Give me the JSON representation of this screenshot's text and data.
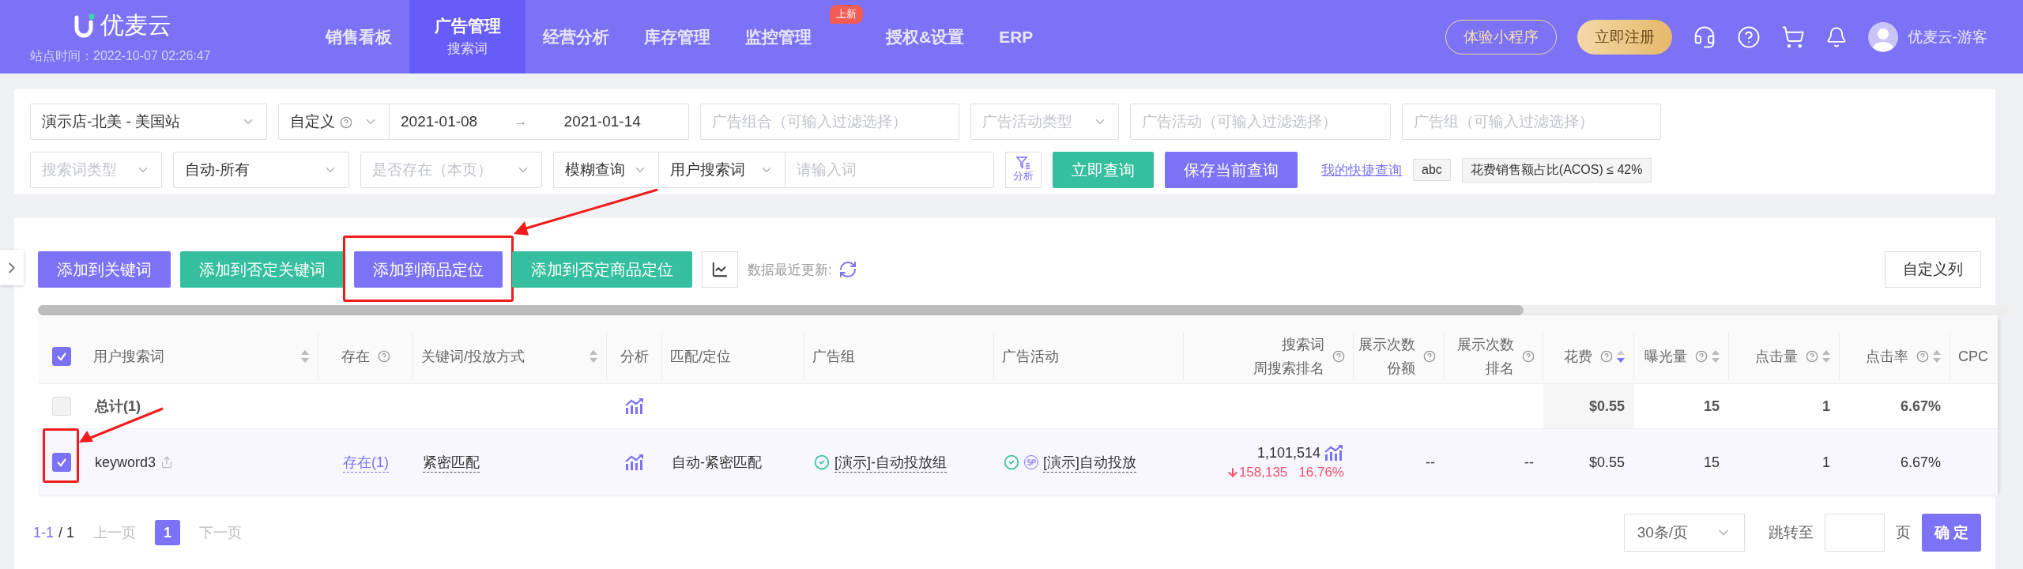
{
  "header": {
    "logo_text": "优麦云",
    "site_time": "站点时间：2022-10-07 02:26:47",
    "nav": [
      {
        "label": "销售看板",
        "selected": false
      },
      {
        "label": "广告管理",
        "sublabel": "搜索词",
        "selected": true
      },
      {
        "label": "经营分析",
        "selected": false
      },
      {
        "label": "库存管理",
        "selected": false
      },
      {
        "label": "监控管理",
        "badge": "上新",
        "selected": false
      },
      {
        "label": "授权&设置",
        "selected": false
      },
      {
        "label": "ERP",
        "selected": false
      }
    ],
    "buttons": [
      {
        "label": "体验小程序",
        "kind": "outline"
      },
      {
        "label": "立即注册",
        "kind": "gold"
      }
    ],
    "user": "优麦云-游客"
  },
  "filters": {
    "row1": [
      {
        "kind": "select",
        "value": "演示店-北美 - 美国站",
        "chevron": true
      },
      {
        "kind": "date_range",
        "preset": "自定义",
        "start": "2021-01-08",
        "separator": "→",
        "end": "2021-01-14"
      },
      {
        "kind": "select",
        "placeholder": "广告组合（可输入过滤选择）",
        "chevron": false
      },
      {
        "kind": "select",
        "placeholder": "广告活动类型",
        "chevron": true
      },
      {
        "kind": "select",
        "placeholder": "广告活动（可输入过滤选择）",
        "chevron": false
      },
      {
        "kind": "select",
        "placeholder": "广告组（可输入过滤选择）",
        "chevron": false
      }
    ],
    "row2": [
      {
        "kind": "select",
        "placeholder": "搜索词类型",
        "chevron": true
      },
      {
        "kind": "select",
        "value": "自动-所有",
        "chevron": true
      },
      {
        "kind": "select",
        "placeholder": "是否存在（本页）",
        "chevron": true
      },
      {
        "kind": "query",
        "mode": "模糊查询",
        "field": "用户搜索词",
        "placeholder": "请输入词"
      }
    ],
    "analyze_label": "分析",
    "buttons": [
      {
        "label": "立即查询",
        "kind": "success"
      },
      {
        "label": "保存当前查询",
        "kind": "primary"
      }
    ],
    "quick_link": "我的快捷查询",
    "tags": [
      "abc",
      "花费销售额占比(ACOS) ≤ 42%"
    ]
  },
  "toolbar": {
    "buttons": [
      {
        "label": "添加到关键词",
        "kind": "primary",
        "highlighted": false
      },
      {
        "label": "添加到否定关键词",
        "kind": "success",
        "highlighted": false
      },
      {
        "label": "添加到商品定位",
        "kind": "primary",
        "highlighted": true
      },
      {
        "label": "添加到否定商品定位",
        "kind": "success",
        "highlighted": false
      }
    ],
    "updated_label": "数据最近更新:",
    "columns_button": "自定义列"
  },
  "table": {
    "all_checked": true,
    "columns": [
      {
        "label": "用户搜索词",
        "help": false,
        "sortable": true,
        "sort_active": false
      },
      {
        "label": "存在",
        "help": true,
        "sortable": false
      },
      {
        "label": "关键词/投放方式",
        "help": false,
        "sortable": true,
        "sort_active": false
      },
      {
        "label": "分析",
        "help": false,
        "sortable": false
      },
      {
        "label": "匹配/定位",
        "help": false,
        "sortable": false
      },
      {
        "label": "广告组",
        "help": false,
        "sortable": false
      },
      {
        "label": "广告活动",
        "help": false,
        "sortable": false
      },
      {
        "label": "搜索词",
        "label2": "周搜索排名",
        "help": true,
        "sortable": false
      },
      {
        "label": "展示次数",
        "label2": "份额",
        "help": true,
        "sortable": false
      },
      {
        "label": "展示次数",
        "label2": "排名",
        "help": true,
        "sortable": false
      },
      {
        "label": "花费",
        "help": true,
        "sortable": true,
        "sort_active": true
      },
      {
        "label": "曝光量",
        "help": true,
        "sortable": true,
        "sort_active": false
      },
      {
        "label": "点击量",
        "help": true,
        "sortable": true,
        "sort_active": false
      },
      {
        "label": "点击率",
        "help": true,
        "sortable": true,
        "sort_active": false
      },
      {
        "label": "CPC",
        "help": false,
        "sortable": false
      }
    ],
    "rows": [
      {
        "kind": "total",
        "checked": false,
        "highlighted": false,
        "label": "总计(1)",
        "spend": "$0.55",
        "impressions": "15",
        "clicks": "1",
        "ctr": "6.67%"
      },
      {
        "kind": "data",
        "checked": true,
        "highlighted": true,
        "keyword": "keyword3",
        "exists": "存在(1)",
        "match": "紧密匹配",
        "targeting": "自动-紧密匹配",
        "ad_group": "[演示]-自动投放组",
        "campaign": "[演示]自动投放",
        "rank": "1,101,514",
        "rank_change": "158,135",
        "rank_change_pct": "16.76%",
        "share": "--",
        "impr_rank": "--",
        "spend": "$0.55",
        "impressions": "15",
        "clicks": "1",
        "ctr": "6.67%"
      }
    ]
  },
  "pagination": {
    "range": "1-1",
    "total": "/ 1",
    "prev": "上一页",
    "pages": [
      {
        "label": "1",
        "selected": true
      }
    ],
    "next": "下一页",
    "page_size": "30条/页",
    "jump_label": "跳转至",
    "page_unit": "页",
    "confirm": "确 定"
  }
}
